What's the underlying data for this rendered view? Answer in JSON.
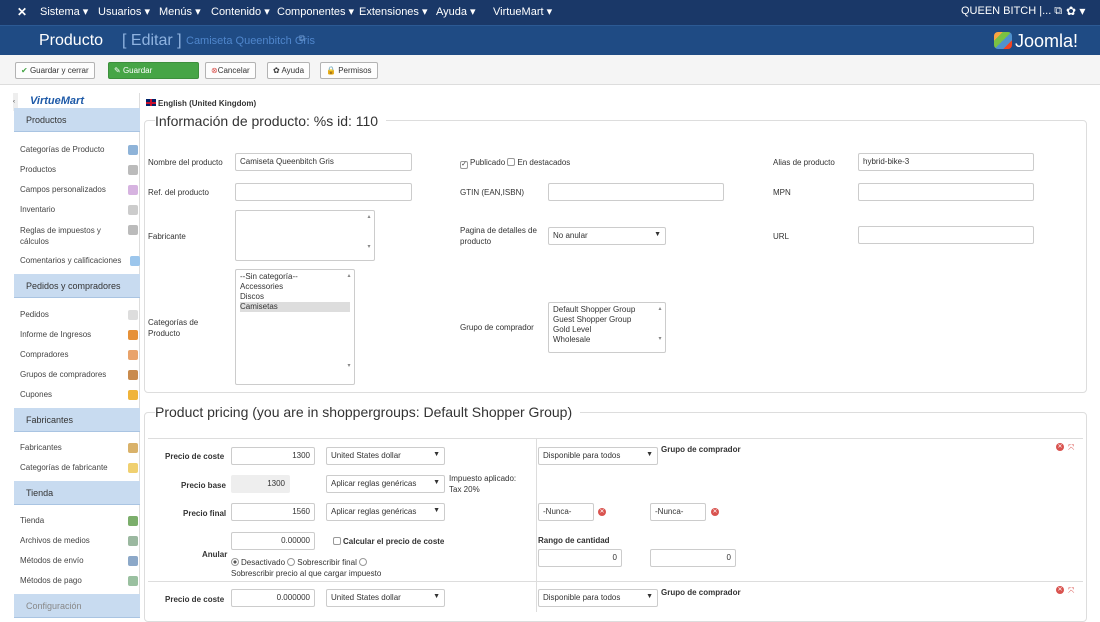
{
  "topnav": {
    "logo": "✕",
    "menus": [
      "Sistema ▾",
      "Usuarios ▾",
      "Menús ▾",
      "Contenido ▾",
      "Componentes ▾",
      "Extensiones ▾",
      "Ayuda ▾",
      "VirtueMart ▾"
    ],
    "user": "QUEEN BITCH |... ⧉",
    "cog": "✿ ▾"
  },
  "header": {
    "title": "Producto",
    "bracket_edit": "[ Editar ]",
    "product_name": "Camiseta Queenbitch Gris",
    "ext_icon": "⧉",
    "brand": "Joomla!"
  },
  "toolbar": {
    "save_close": "Guardar y cerrar",
    "save": "Guardar",
    "cancel": "Cancelar",
    "help": "Ayuda",
    "permissions": "Permisos"
  },
  "sidebar": {
    "logo": "VirtueMart",
    "collapse": "‹",
    "sections": [
      {
        "title": "Productos",
        "items": [
          "Categorías de Producto",
          "Productos",
          "Campos personalizados",
          "Inventario",
          "Reglas de impuestos y cálculos",
          "Comentarios y calificaciones"
        ]
      },
      {
        "title": "Pedidos y compradores",
        "items": [
          "Pedidos",
          "Informe de Ingresos",
          "Compradores",
          "Grupos de compradores",
          "Cupones"
        ]
      },
      {
        "title": "Fabricantes",
        "items": [
          "Fabricantes",
          "Categorías de fabricante"
        ]
      },
      {
        "title": "Tienda",
        "items": [
          "Tienda",
          "Archivos de medios",
          "Métodos de envío",
          "Métodos de pago"
        ]
      },
      {
        "title": "Configuración",
        "items": []
      }
    ]
  },
  "main": {
    "language": "English (United Kingdom)",
    "info_title": "Información de producto: %s id: 110",
    "product_name_label": "Nombre del producto",
    "product_name_value": "Camiseta Queenbitch Gris",
    "published_label": "Publicado",
    "featured_label": "En destacados",
    "alias_label": "Alias de producto",
    "alias_value": "hybrid-bike-3",
    "ref_label": "Ref. del producto",
    "gtin_label": "GTIN (EAN,ISBN)",
    "mpn_label": "MPN",
    "manufacturer_label": "Fabricante",
    "detail_page_label": "Pagina de detalles de producto",
    "detail_page_value": "No anular",
    "url_label": "URL",
    "categories_label": "Categorías de Producto",
    "categories": [
      "--Sin categoría--",
      "Accessories",
      "Discos",
      "Camisetas"
    ],
    "categories_selected": "Camisetas",
    "shopper_group_label": "Grupo de comprador",
    "shopper_groups": [
      "Default Shopper Group",
      "Guest Shopper Group",
      "Gold Level",
      "Wholesale"
    ],
    "pricing_title": "Product pricing (you are in shoppergroups: Default Shopper Group)",
    "price_rows": [
      {
        "cost_label": "Precio de coste",
        "cost_value": "1300",
        "currency": "United States dollar",
        "availability": "Disponible para todos",
        "group_label": "Grupo de comprador"
      },
      {
        "cost_label": "Precio de coste",
        "cost_value": "0.000000",
        "currency": "United States dollar",
        "availability": "Disponible para todos",
        "group_label": "Grupo de comprador"
      }
    ],
    "base_label": "Precio base",
    "base_value": "1300",
    "rules_value": "Aplicar reglas genéricas",
    "tax_applied": "Impuesto aplicado:",
    "tax_value": "Tax 20%",
    "final_label": "Precio final",
    "final_value": "1560",
    "never_1": "-Nunca-",
    "never_2": "-Nunca-",
    "override_label": "Anular",
    "override_value": "0.00000",
    "calc_cost_label": "Calcular el precio de coste",
    "qty_label": "Rango de cantidad",
    "qty_start": "0",
    "qty_end": "0",
    "radio_deactivated": "Desactivado",
    "radio_overwrite": "Sobrescribir final",
    "radio_pre_tax": "Sobrescribir precio al que cargar impuesto"
  },
  "colors": {
    "topbar": "#1a3868",
    "subhead": "#1f4b84",
    "green": "#46a546",
    "sidebar_head": "#c8dbf0"
  }
}
